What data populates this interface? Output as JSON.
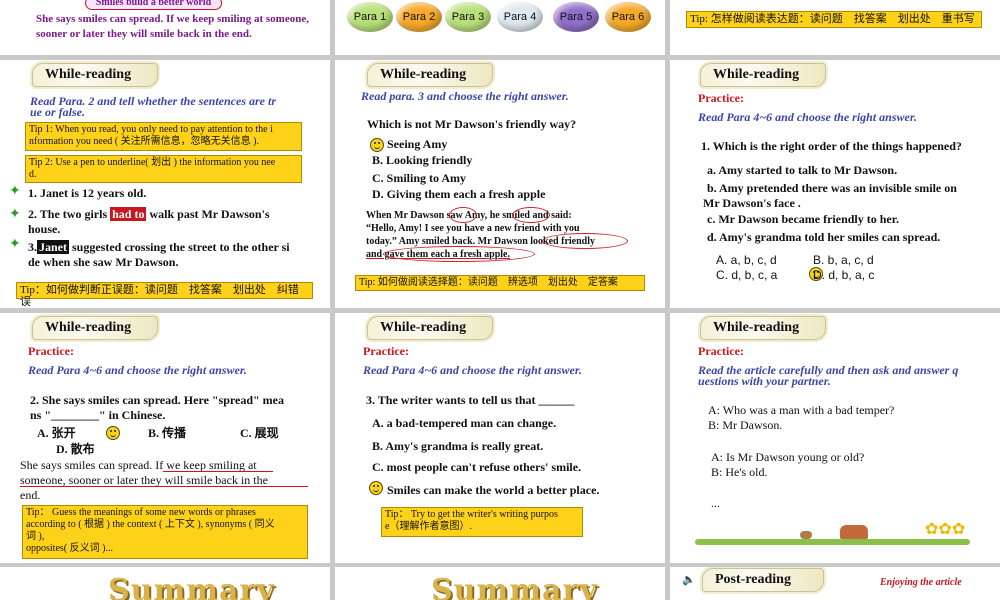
{
  "s0": {
    "title": "Smiles build a better world",
    "text": [
      "She says smiles can spread. If we keep smiling at someone,",
      "sooner or later they will smile back in the end."
    ]
  },
  "s1": {
    "buttons": [
      {
        "label": "Para 1",
        "color": "#b8e07a"
      },
      {
        "label": "Para 2",
        "color": "#f6a92a"
      },
      {
        "label": "Para 3",
        "color": "#b8e07a"
      },
      {
        "label": "Para 4",
        "color": "#dfe8ef"
      },
      {
        "label": "Para 5",
        "color": "#8f6fc8"
      },
      {
        "label": "Para 6",
        "color": "#f6a92a"
      }
    ]
  },
  "s2": {
    "tip": "Tip: 怎样做阅读表达题：读问题　找答案　划出处　重书写"
  },
  "s3": {
    "banner": "While-reading",
    "instruction": [
      "Read Para. 2 and tell whether the sentences are tr",
      "ue or false."
    ],
    "tip1": [
      "Tip 1: When you read, you only need to pay attention to the i",
      "nformation you need ( 关注所需信息，忽略无关信息 )."
    ],
    "tip2": [
      "Tip 2: Use a pen to underline( 划出 ) the information you nee",
      "d."
    ],
    "s1": "1. Janet is 12 years old.",
    "s2_pre": "2. The two girls ",
    "s2_box": "had to",
    "s2_post": " walk past Mr Dawson's",
    "s2_l2": "house.",
    "s3_pre": "3.",
    "s3_box": "Janet",
    "s3_post": " suggested crossing the street to the other si",
    "s3_l2": "de when she saw Mr Dawson.",
    "tip3": "Tip：如何做判断正误题：读问题　找答案　划出处　纠错误"
  },
  "s4": {
    "banner": "While-reading",
    "instruction": "Read para. 3 and choose the right answer.",
    "question": "Which is not Mr Dawson's friendly way?",
    "options": [
      "Seeing Amy",
      "B.  Looking friendly",
      "C.  Smiling to Amy",
      "D. Giving them each a fresh apple"
    ],
    "passage": [
      "When Mr Dawson saw Amy, he smiled and said:",
      "“Hello, Amy! I see you have a new friend with you",
      "today.” Amy smiled back. Mr Dawson looked friendly",
      "and gave them each a fresh apple."
    ],
    "tip": "Tip: 如何做阅读选择题：读问题　辨选项　划出处　定答案"
  },
  "s5": {
    "banner": "While-reading",
    "practice": "Practice:",
    "instruction": "Read Para 4~6 and choose the right answer.",
    "question": "1. Which is the right order of the things happened?",
    "items": [
      "a. Amy started to talk to Mr Dawson.",
      "b. Amy pretended there was an invisible smile on",
      "Mr Dawson's face .",
      "c. Mr Dawson became friendly to her.",
      "d. Amy's grandma told her smiles can spread."
    ],
    "choices": [
      "A. a, b, c, d",
      "B. b, a, c, d",
      "C. d, b, c, a",
      "D. d, b, a, c"
    ]
  },
  "s6": {
    "banner": "While-reading",
    "practice": "Practice:",
    "instruction": "Read Para 4~6 and choose the right answer.",
    "question": [
      "2. She says smiles can spread. Here \"spread\" mea",
      "ns \"________\" in Chinese."
    ],
    "opt_a": "A.  张开",
    "opt_b": "B.  传播",
    "opt_c": "C.  展现",
    "opt_d": "D.  散布",
    "quote": [
      "She says smiles can spread. If we keep smiling at",
      "someone, sooner or later they will smile back in the",
      "end."
    ],
    "tip": [
      "Tip：  Guess the meanings of some new words or phrases",
      "according to ( 根据 ) the context ( 上下文 ), synonyms ( 同义",
      "词 ),",
      "opposites( 反义词 )..."
    ]
  },
  "s7": {
    "banner": "While-reading",
    "practice": "Practice:",
    "instruction": "Read Para 4~6 and choose the right answer.",
    "question": "3. The writer wants to tell us that ______",
    "options": [
      "A. a bad-tempered man can change.",
      "B. Amy's grandma is really great.",
      "C. most people can't refuse others' smile.",
      "Smiles can make the world a better place."
    ],
    "tip": [
      "Tip：  Try to get the writer's writing purpos",
      "e（理解作者意图）."
    ]
  },
  "s8": {
    "banner": "While-reading",
    "practice": "Practice:",
    "instruction": [
      "Read the article carefully and then ask and answer q",
      "uestions with your partner."
    ],
    "dialog": [
      "A: Who was a man with a bad temper?",
      "B: Mr Dawson.",
      "A: Is Mr Dawson young or old?",
      "B: He's old.",
      "..."
    ]
  },
  "s9": {
    "title": "Summary"
  },
  "s10": {
    "title": "Summary"
  },
  "s11": {
    "banner": "Post-reading",
    "caption": "Enjoying the article"
  }
}
